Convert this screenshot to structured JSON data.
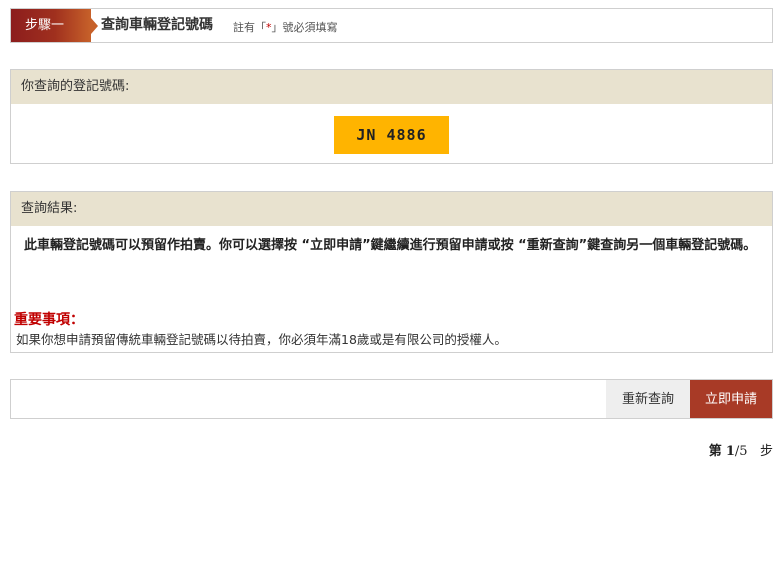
{
  "step_header": {
    "tab_label": "步驟一",
    "title": "查詢車輛登記號碼",
    "note_prefix": "註有「",
    "note_star": "*",
    "note_suffix": "」號必須填寫"
  },
  "plate_panel": {
    "heading": "你查詢的登記號碼:",
    "plate_number": "JN 4886",
    "plate_color": "#ffb400"
  },
  "result_panel": {
    "heading": "查詢結果:",
    "message": "此車輛登記號碼可以預留作拍賣。你可以選擇按 “立即申請”鍵繼續進行預留申請或按 “重新查詢”鍵查詢另一個車輛登記號碼。",
    "important_title": "重要事項：",
    "important_text": "如果你想申請預留傳統車輛登記號碼以待拍賣，你必須年滿18歲或是有限公司的授權人。"
  },
  "actions": {
    "requery_label": "重新查詢",
    "apply_label": "立即申請"
  },
  "step_counter": {
    "prefix": "第",
    "current": "1",
    "separator": "/",
    "total": "5",
    "suffix": "步"
  },
  "colors": {
    "brand_red": "#a83a26",
    "panel_header_bg": "#e8e2cf",
    "important_red": "#c00000"
  }
}
